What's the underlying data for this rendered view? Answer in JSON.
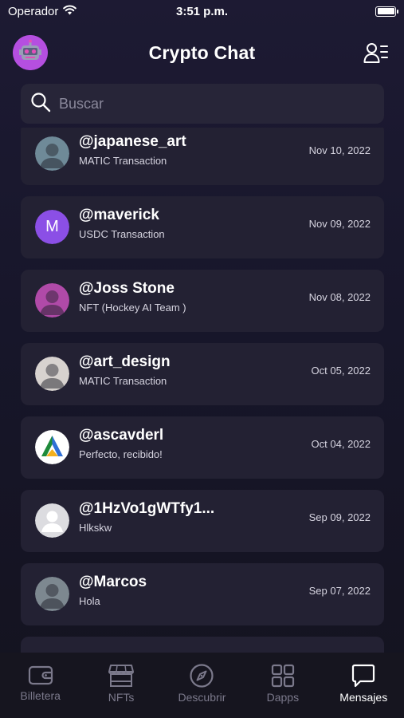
{
  "status_bar": {
    "carrier": "Operador",
    "time": "3:51 p.m.",
    "battery_level": 1.0
  },
  "header": {
    "title": "Crypto Chat",
    "avatar_icon": "robot-avatar-icon",
    "contacts_icon": "contacts-list-icon"
  },
  "search": {
    "placeholder": "Buscar",
    "value": ""
  },
  "chats": [
    {
      "name": "@japanese_art",
      "subtitle": "MATIC Transaction",
      "date": "Nov 10, 2022",
      "avatar": "photo",
      "avatar_color": "#6f8a98"
    },
    {
      "name": "@maverick",
      "subtitle": "USDC Transaction",
      "date": "Nov 09, 2022",
      "avatar": "letter",
      "avatar_letter": "M",
      "avatar_color": "#8b4fe6"
    },
    {
      "name": "@Joss Stone",
      "subtitle": "NFT (Hockey AI Team )",
      "date": "Nov 08, 2022",
      "avatar": "photo",
      "avatar_color": "#b04aa8"
    },
    {
      "name": "@art_design",
      "subtitle": "MATIC Transaction",
      "date": "Oct 05, 2022",
      "avatar": "photo",
      "avatar_color": "#d7d2cf"
    },
    {
      "name": "@ascavderl",
      "subtitle": "Perfecto, recibido!",
      "date": "Oct 04, 2022",
      "avatar": "logo",
      "avatar_color": "#ffffff"
    },
    {
      "name": "@1HzVo1gWTfy1...",
      "subtitle": "Hlkskw",
      "date": "Sep 09, 2022",
      "avatar": "default",
      "avatar_color": "#d9d9de"
    },
    {
      "name": "@Marcos",
      "subtitle": "Hola",
      "date": "Sep 07, 2022",
      "avatar": "photo",
      "avatar_color": "#7d8890"
    }
  ],
  "tabs": [
    {
      "label": "Billetera",
      "icon": "wallet-icon",
      "active": false
    },
    {
      "label": "NFTs",
      "icon": "store-icon",
      "active": false
    },
    {
      "label": "Descubrir",
      "icon": "compass-icon",
      "active": false
    },
    {
      "label": "Dapps",
      "icon": "grid-icon",
      "active": false
    },
    {
      "label": "Mensajes",
      "icon": "chat-bubble-icon",
      "active": true
    }
  ],
  "colors": {
    "background": "#1b1930",
    "card": "#232133",
    "accent_purple": "#8b4fe6",
    "tab_inactive": "#7b798b"
  }
}
